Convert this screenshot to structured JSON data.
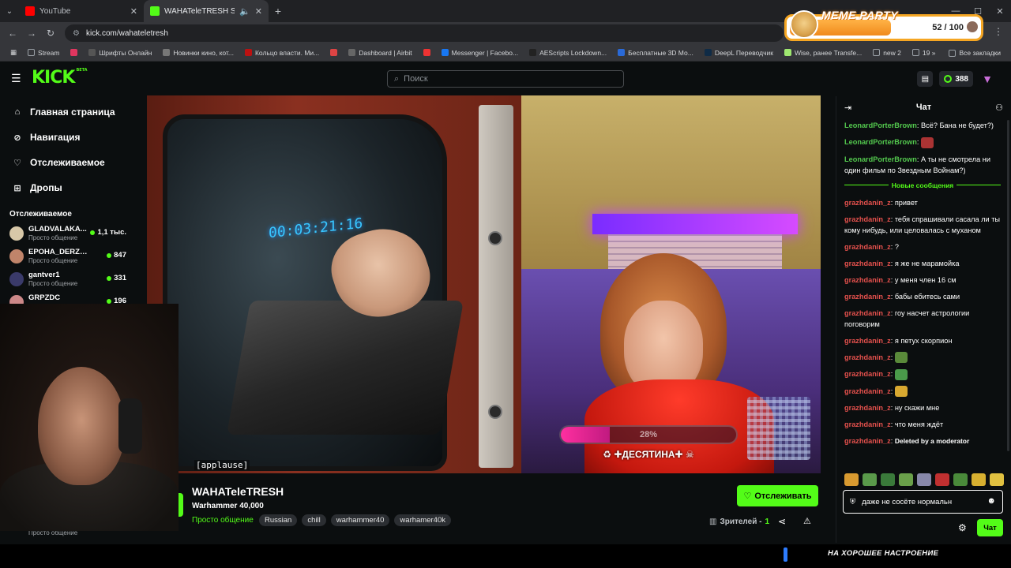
{
  "browser": {
    "tabs": [
      {
        "title": "YouTube",
        "color": "#ff0000",
        "active": false
      },
      {
        "title": "WAHATeleTRESH Stream - V",
        "color": "#53fc18",
        "active": true
      }
    ],
    "url": "kick.com/wahateletresh",
    "bookmarks": [
      {
        "label": "Stream",
        "color": "#9aa0a6"
      },
      {
        "label": "",
        "color": "#e0365f"
      },
      {
        "label": "Шрифты Онлайн",
        "color": "#555"
      },
      {
        "label": "Новинки кино, кот...",
        "color": "#777"
      },
      {
        "label": "Кольцо власти. Ми...",
        "color": "#b11"
      },
      {
        "label": "",
        "color": "#d44"
      },
      {
        "label": "Dashboard | Airbit",
        "color": "#666"
      },
      {
        "label": "",
        "color": "#e33"
      },
      {
        "label": "Messenger | Facebo...",
        "color": "#1877f2"
      },
      {
        "label": "AEScripts Lockdown...",
        "color": "#222"
      },
      {
        "label": "Бесплатные 3D Мо...",
        "color": "#2a6ad8"
      },
      {
        "label": "DeepL Переводчик",
        "color": "#0f2b46"
      },
      {
        "label": "Wise, ранее Transfe...",
        "color": "#9fe870"
      },
      {
        "label": "new 2",
        "color": "#9aa0a6"
      },
      {
        "label": "19",
        "color": "#9aa0a6"
      }
    ],
    "all_bookmarks": "Все закладки"
  },
  "meme": {
    "title": "MEME PARTY",
    "score": "52 / 100",
    "progress": 0.52
  },
  "header": {
    "search_placeholder": "Поиск",
    "coins": "388"
  },
  "sidebar": {
    "nav": [
      {
        "label": "Главная страница",
        "icon": "home-icon"
      },
      {
        "label": "Навигация",
        "icon": "compass-icon"
      },
      {
        "label": "Отслеживаемое",
        "icon": "heart-icon"
      },
      {
        "label": "Дропы",
        "icon": "gift-icon"
      }
    ],
    "following_title": "Отслеживаемое",
    "following": [
      {
        "name": "GLADVALAKA...",
        "category": "Просто общение",
        "viewers": "1,1 тыс.",
        "color": "#d8c8a8"
      },
      {
        "name": "EPOHA_DERZKIH",
        "category": "Просто общение",
        "viewers": "847",
        "color": "#c0846a"
      },
      {
        "name": "gantver1",
        "category": "Просто общение",
        "viewers": "331",
        "color": "#3a3a6a"
      },
      {
        "name": "GRPZDC",
        "category": "",
        "viewers": "196",
        "color": "#c88"
      }
    ],
    "bottom_category": "Просто общение"
  },
  "video": {
    "caption": "[applause]",
    "clock": "00:03:21:16",
    "goal_percent": "28%",
    "goal_fraction": 0.28,
    "goal_label": "♻ ✚ДЕСЯТИНА✚ ☠"
  },
  "stream": {
    "streamer": "WAHATeleTRESH",
    "title": "Warhammer 40,000",
    "category": "Просто общение",
    "tags": [
      "Russian",
      "chill",
      "warhammer40",
      "warhamer40k"
    ],
    "follow": "Отслеживать",
    "viewers_label": "Зрителей -",
    "viewers": "1"
  },
  "chat": {
    "title": "Чат",
    "messages_before": [
      {
        "user": "LeonardPorterBrown",
        "text": "Всё? Бана не будет?)"
      },
      {
        "user": "LeonardPorterBrown",
        "text": "",
        "emote": "#a33"
      },
      {
        "user": "LeonardPorterBrown",
        "text": "А ты не смотрела ни один фильм по Звездным Войнам?)"
      }
    ],
    "new_messages": "Новые сообщения",
    "messages_after": [
      {
        "user": "grazhdanin_z",
        "text": "привет"
      },
      {
        "user": "grazhdanin_z",
        "text": "тебя спрашивали сасала ли ты кому нибудь, или целовалась с муханом"
      },
      {
        "user": "grazhdanin_z",
        "text": "?"
      },
      {
        "user": "grazhdanin_z",
        "text": "я же не марамойка"
      },
      {
        "user": "grazhdanin_z",
        "text": "у меня член 16 см"
      },
      {
        "user": "grazhdanin_z",
        "text": "бабы ебитесь сами"
      },
      {
        "user": "grazhdanin_z",
        "text": "гоу насчет астрологии поговорим"
      },
      {
        "user": "grazhdanin_z",
        "text": "я петух скорпион"
      },
      {
        "user": "grazhdanin_z",
        "text": "",
        "emote": "#5a8a3a"
      },
      {
        "user": "grazhdanin_z",
        "text": "",
        "emote": "#4a9a4a"
      },
      {
        "user": "grazhdanin_z",
        "text": "",
        "emote": "#d8a830"
      },
      {
        "user": "grazhdanin_z",
        "text": "ну скажи мне"
      },
      {
        "user": "grazhdanin_z",
        "text": "что меня ждёт"
      },
      {
        "user": "grazhdanin_z",
        "text": "Deleted by a moderator"
      }
    ],
    "emote_colors": [
      "#d89a30",
      "#5a9a4a",
      "#3a7a3a",
      "#6aa04a",
      "#8888aa",
      "#c03030",
      "#4a8a3a",
      "#d8b030",
      "#e0c040"
    ],
    "input_value": "даже не сосёте нормальн",
    "send": "Чат"
  },
  "overlay_bottom": "НА ХОРОШЕЕ НАСТРОЕНИЕ"
}
